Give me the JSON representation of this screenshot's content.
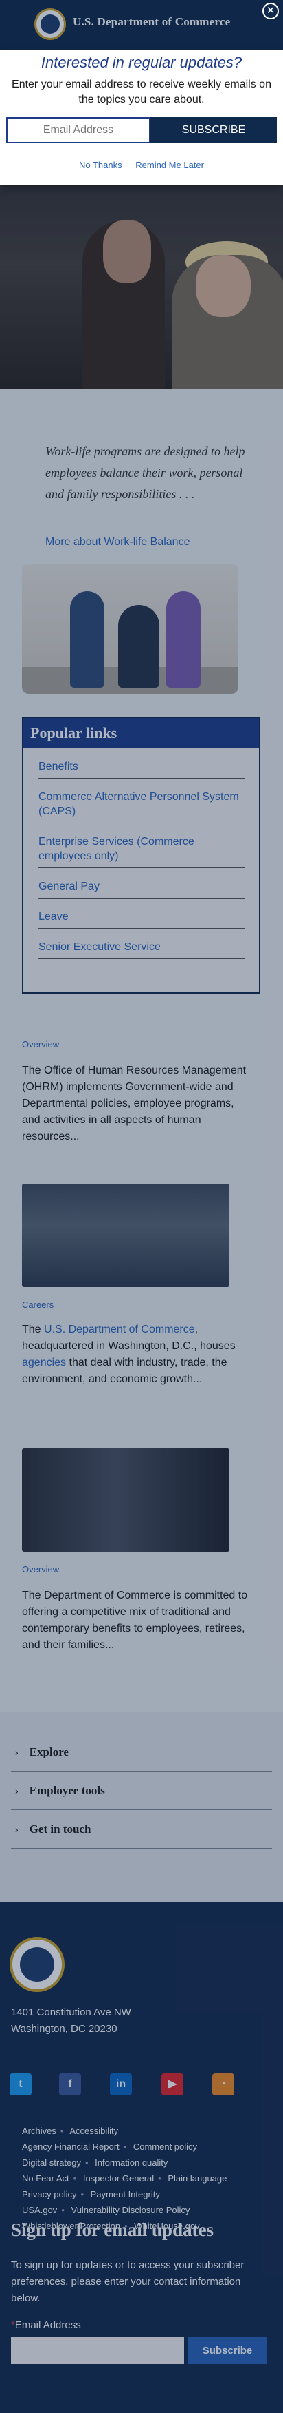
{
  "header": {
    "title": "U.S. Department of Commerce",
    "close_label": "✕"
  },
  "modal": {
    "heading": "Interested in regular updates?",
    "text": "Enter your email address to receive weekly emails on the topics you care about.",
    "email_placeholder": "Email Address",
    "subscribe_label": "SUBSCRIBE",
    "no_thanks": "No Thanks",
    "remind": "Remind Me Later"
  },
  "worklife": {
    "quote": "Work-life programs are designed to help employees balance their work, personal and family responsibilities . . .",
    "more_link": "More about Work-life Balance"
  },
  "popular": {
    "heading": "Popular links",
    "items": [
      "Benefits",
      "Commerce Alternative Personnel System (CAPS)",
      "Enterprise Services (Commerce employees only)",
      "General Pay",
      "Leave",
      "Senior Executive Service"
    ]
  },
  "overview1": {
    "eyebrow": "Overview",
    "text": "The Office of Human Resources Management (OHRM) implements Government-wide and Departmental policies, employee programs, and activities in all aspects of human resources..."
  },
  "careers": {
    "eyebrow": "Careers",
    "text_prefix": "The ",
    "link1": "U.S. Department of Commerce",
    "text_mid": ", headquartered in Washington, D.C., houses ",
    "link2": "agencies",
    "text_suffix": " that deal with industry, trade, the environment, and economic growth..."
  },
  "overview2": {
    "eyebrow": "Overview",
    "text": "The Department of Commerce is committed to offering a competitive mix of traditional and contemporary benefits to employees, retirees, and their families..."
  },
  "accordion": {
    "items": [
      "Explore",
      "Employee tools",
      "Get in touch"
    ],
    "chevron": "›"
  },
  "footer": {
    "address1": "1401 Constitution Ave NW",
    "address2": "Washington, DC 20230",
    "social": [
      {
        "name": "twitter-icon",
        "glyph": "t"
      },
      {
        "name": "facebook-icon",
        "glyph": "f"
      },
      {
        "name": "linkedin-icon",
        "glyph": "in"
      },
      {
        "name": "youtube-icon",
        "glyph": "▶"
      },
      {
        "name": "rss-icon",
        "glyph": "◔"
      }
    ],
    "links": [
      "Archives",
      "Accessibility",
      "Agency Financial Report",
      "Comment policy",
      "Digital strategy",
      "Information quality",
      "No Fear Act",
      "Inspector General",
      "Plain language",
      "Privacy policy",
      "Payment Integrity",
      "USA.gov",
      "Vulnerability Disclosure Policy",
      "Whistleblower Protection",
      "WhiteHouse.gov"
    ],
    "signup_heading": "Sign up for email updates",
    "signup_text": "To sign up for updates or to access your subscriber preferences, please enter your contact information below.",
    "email_label": "Email Address",
    "required_mark": "*",
    "subscribe_label": "Subscribe"
  }
}
